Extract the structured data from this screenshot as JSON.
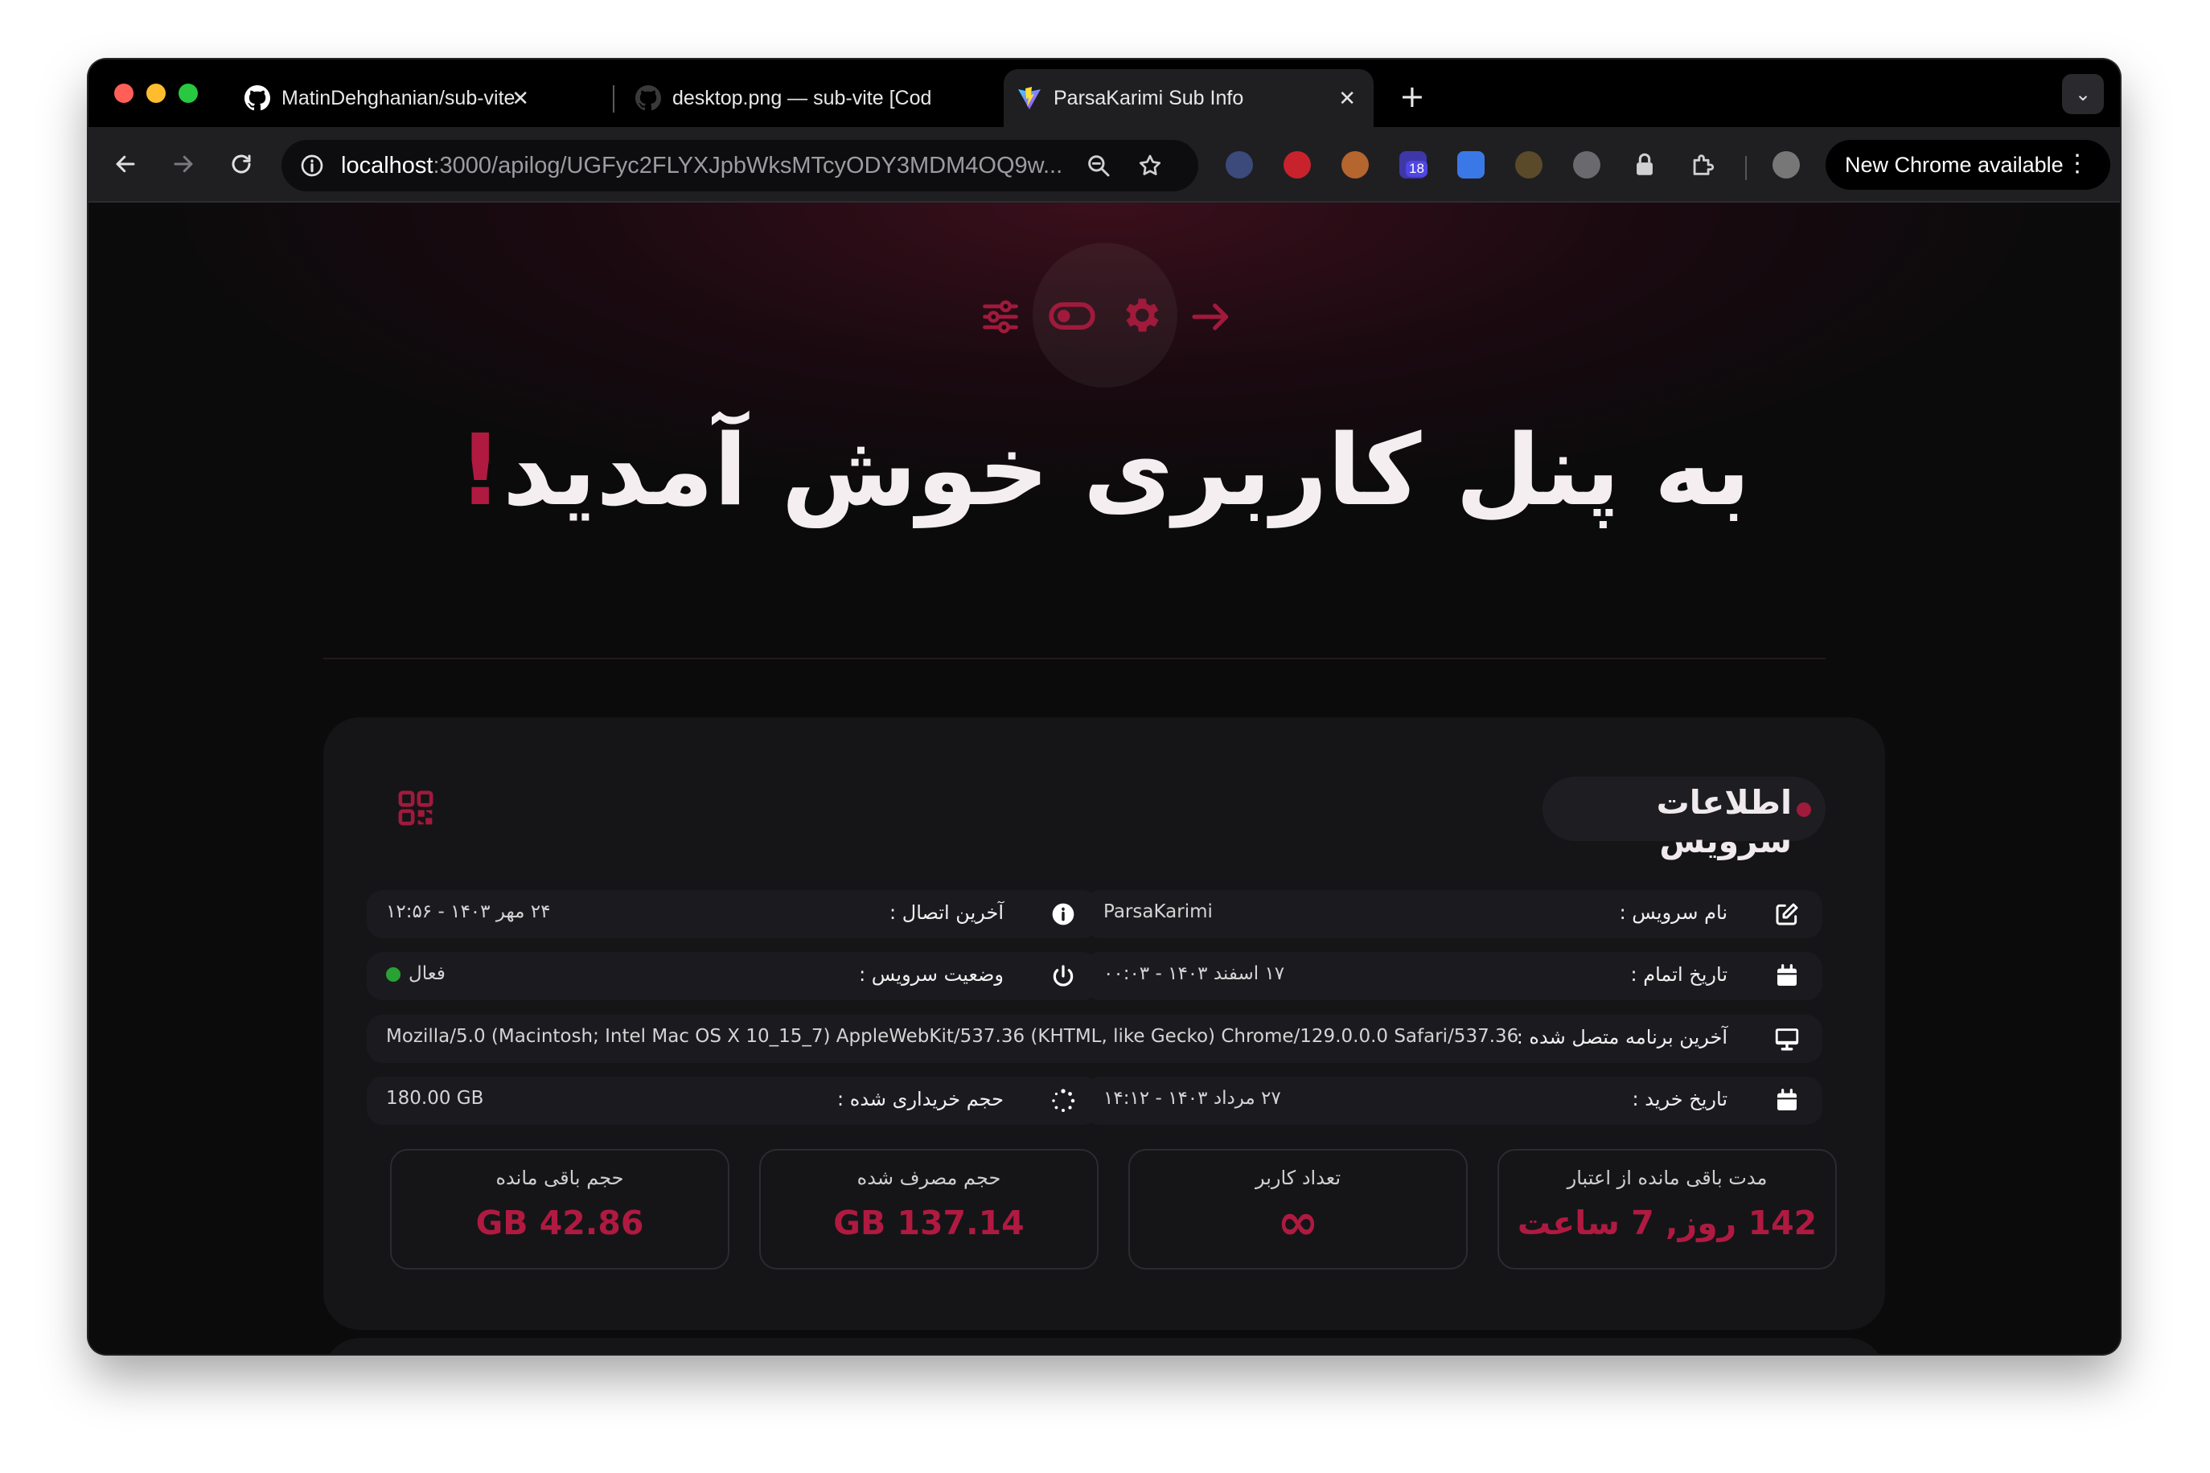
{
  "browser": {
    "tabs": [
      {
        "title": "MatinDehghanian/sub-vite",
        "icon": "github-icon"
      },
      {
        "title": "desktop.png — sub-vite [Cod",
        "icon": "github-icon"
      },
      {
        "title": "ParsaKarimi Sub Info",
        "icon": "vite-icon",
        "active": true
      }
    ],
    "url_host": "localhost",
    "url_rest": ":3000/apilog/UGFyc2FLYXJpbWksMTcyODY3MDM4OQ9w...",
    "new_chrome_label": "New Chrome available",
    "extension_badge": "18"
  },
  "hero": {
    "title": "به پنل کاربری خوش آمدید",
    "exclaim": "!"
  },
  "service": {
    "section_title": "اطلاعات سرویس",
    "rows": {
      "name_label": "نام سرویس :",
      "name_value": "ParsaKarimi",
      "last_conn_label": "آخرین اتصال :",
      "last_conn_value": "۲۴ مهر ۱۴۰۳ - ۱۲:۵۶",
      "expire_label": "تاریخ اتمام :",
      "expire_value": "۱۷ اسفند ۱۴۰۳ - ۰۰:۰۳",
      "status_label": "وضعیت سرویس :",
      "status_value": "فعال",
      "app_label": "آخرین برنامه متصل شده :",
      "app_value": "Mozilla/5.0 (Macintosh; Intel Mac OS X 10_15_7) AppleWebKit/537.36 (KHTML, like Gecko) Chrome/129.0.0.0 Safari/537.36",
      "purchase_date_label": "تاریخ خرید :",
      "purchase_date_value": "۲۷ مرداد ۱۴۰۳ - ۱۴:۱۲",
      "purchased_volume_label": "حجم خریداری شده :",
      "purchased_volume_value": "180.00 GB"
    },
    "stats": [
      {
        "label": "مدت باقی مانده از اعتبار",
        "value": "142 روز, 7 ساعت"
      },
      {
        "label": "تعداد کاربر",
        "value": "∞"
      },
      {
        "label": "حجم مصرف شده",
        "value": "137.14 GB"
      },
      {
        "label": "حجم باقی مانده",
        "value": "42.86 GB"
      }
    ]
  },
  "colors": {
    "accent": "#b01a40",
    "card": "#151518",
    "row": "#1b1b1f",
    "status_active": "#2aa133"
  }
}
